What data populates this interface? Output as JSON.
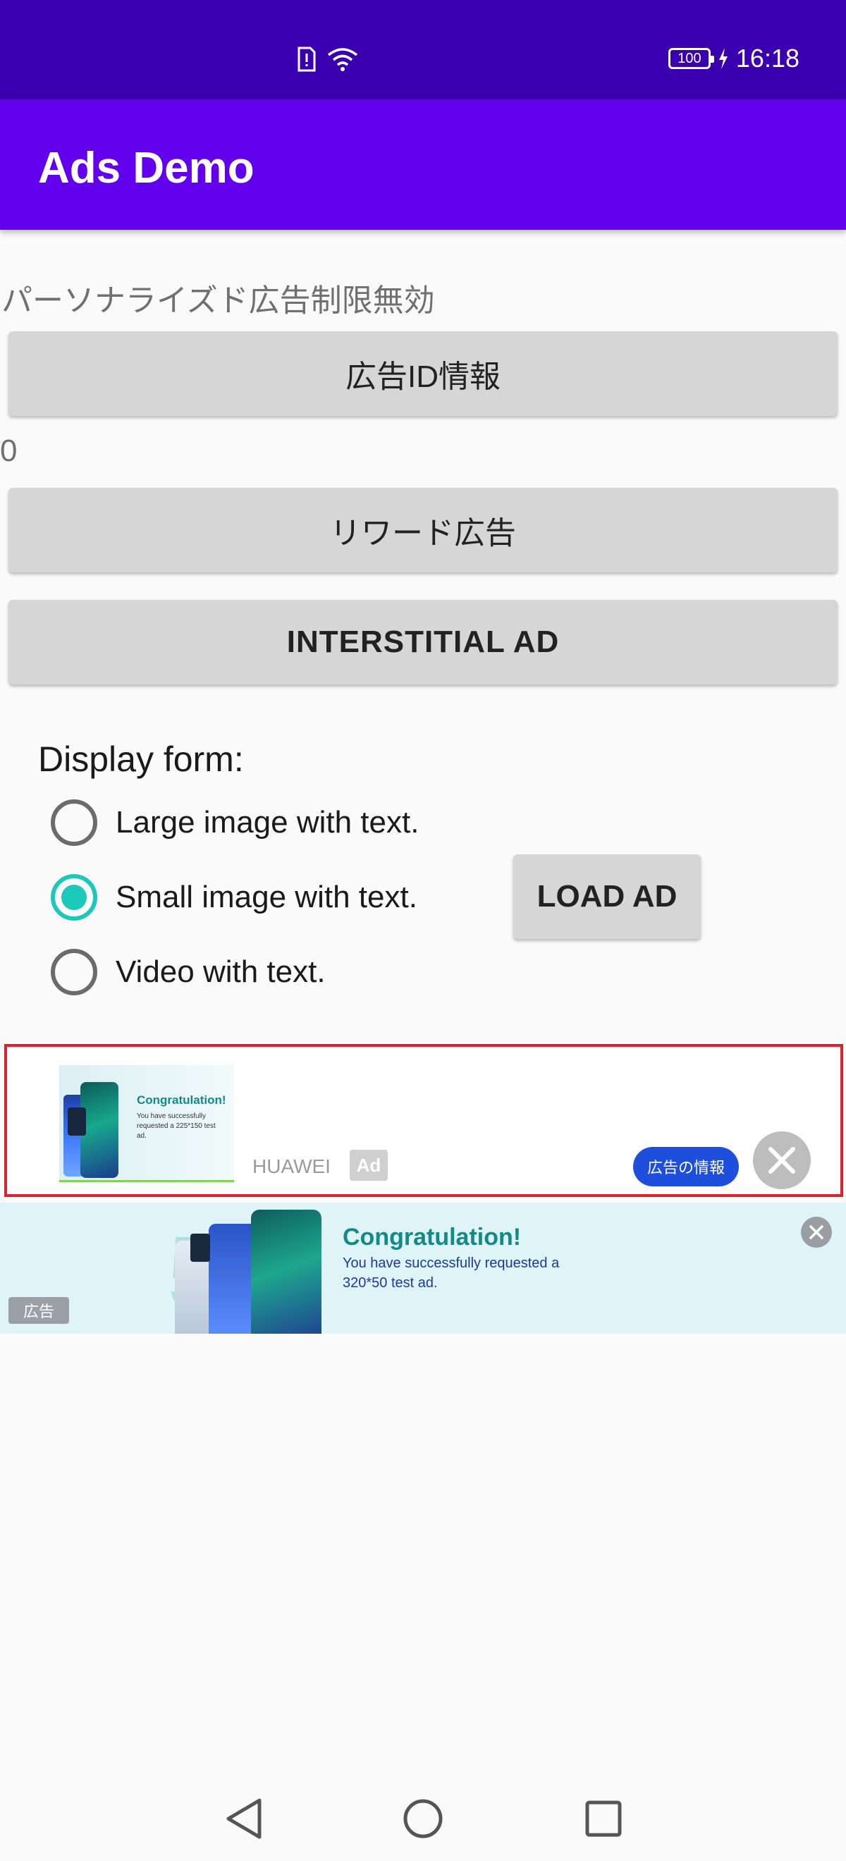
{
  "status_bar": {
    "time": "16:18",
    "battery": "100",
    "icons": [
      "sim-alert-icon",
      "wifi-icon",
      "battery-icon",
      "charging-icon"
    ]
  },
  "app_bar": {
    "title": "Ads Demo"
  },
  "content": {
    "personalized_status": "パーソナライズド広告制限無効",
    "ad_id_button": "広告ID情報",
    "reward_count": "0",
    "reward_button": "リワード広告",
    "interstitial_button": "INTERSTITIAL AD",
    "display_form_label": "Display form:",
    "radio_options": [
      {
        "label": "Large image with text.",
        "selected": false
      },
      {
        "label": "Small image with text.",
        "selected": true
      },
      {
        "label": "Video with text.",
        "selected": false
      }
    ],
    "load_ad_button": "LOAD AD"
  },
  "native_ad": {
    "image_title": "Congratulation!",
    "image_text": "You have successfully requested a 225*150 test ad.",
    "brand": "HUAWEI",
    "badge": "Ad",
    "info_button": "広告の情報"
  },
  "banner_ad": {
    "title": "Congratulation!",
    "text": "You have successfully requested a 320*50 test ad.",
    "badge": "広告"
  },
  "colors": {
    "status_bar": "#3a00b0",
    "app_bar": "#6200ee",
    "radio_accent": "#1cc8b8",
    "ad_border": "#e1202a",
    "ad_info_button": "#1e4fdc"
  }
}
